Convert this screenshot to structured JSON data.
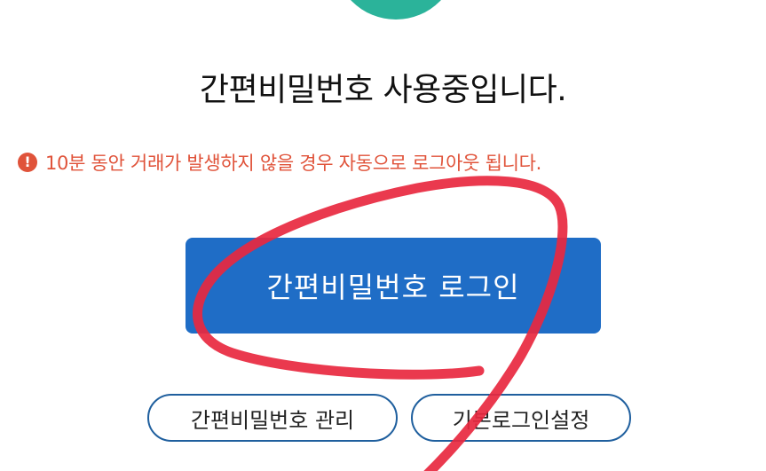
{
  "status": {
    "title": "간편비밀번호 사용중입니다."
  },
  "notice": {
    "icon": "exclamation-circle-icon",
    "text": "10분 동안 거래가 발생하지 않을 경우 자동으로 로그아웃 됩니다.",
    "color": "#e0533a"
  },
  "buttons": {
    "login_label": "간편비밀번호 로그인",
    "manage_label": "간편비밀번호 관리",
    "default_login_label": "기본로그인설정"
  },
  "colors": {
    "accent_teal": "#2bb39a",
    "primary_blue": "#1f6dc6",
    "annotation_red": "#e8283f"
  }
}
